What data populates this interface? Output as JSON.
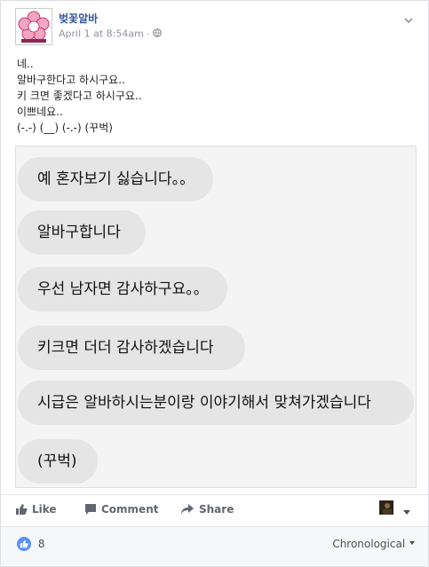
{
  "post": {
    "page_name": "벚꽃알바",
    "timestamp": "April 1 at 8:54am",
    "separator": "·",
    "privacy_icon": "globe-icon",
    "avatar_lines": [
      "벚꽃",
      "알바"
    ],
    "message_lines": [
      "네..",
      "알바구한다고 하시구요..",
      "키 크면 좋겠다고 하시구요..",
      "이쁘네요..",
      "(-.-) (__) (-.-) (꾸벅)"
    ]
  },
  "screenshot": {
    "bubbles": [
      "예 혼자보기 싫습니다。。",
      "알바구합니다",
      "우선 남자면 감사하구요。。",
      "키크면 더더 감사하겠습니다",
      "시급은 알바하시는분이랑 이야기해서 맞쳐가겠습니다",
      "(꾸벅)"
    ]
  },
  "actions": {
    "like": "Like",
    "comment": "Comment",
    "share": "Share"
  },
  "footer": {
    "like_count": "8",
    "sort_label": "Chronological"
  },
  "colors": {
    "link": "#365899",
    "like_blue": "#5890ff",
    "bubble": "#e5e5e5"
  }
}
